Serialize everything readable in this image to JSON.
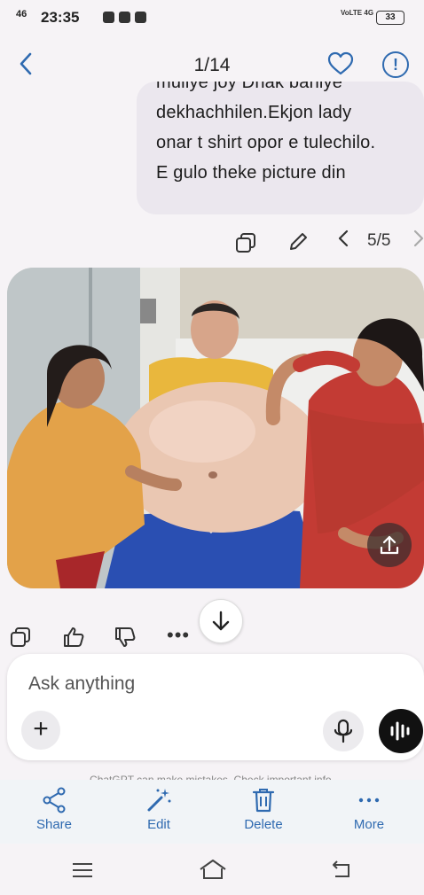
{
  "status_bar": {
    "signal": "46",
    "time": "23:35",
    "network": "VoLTE 4G",
    "battery": "33"
  },
  "header": {
    "position": "1/14"
  },
  "message": {
    "lines": [
      "muliye joy Dhak baniye",
      "dekhachhilen.Ekjon lady",
      "onar t shirt opor e tulechilo.",
      "E gulo theke picture din"
    ]
  },
  "message_toolbar": {
    "pager": "5/5"
  },
  "composer": {
    "placeholder": "Ask anything"
  },
  "disclaimer": "ChatGPT can make mistakes. Check important info.",
  "bottom_bar": {
    "share": "Share",
    "edit": "Edit",
    "delete": "Delete",
    "more": "More"
  },
  "colors": {
    "accent": "#2f6ab0",
    "background": "#f6f3f6",
    "bubble": "#ebe7ee"
  }
}
